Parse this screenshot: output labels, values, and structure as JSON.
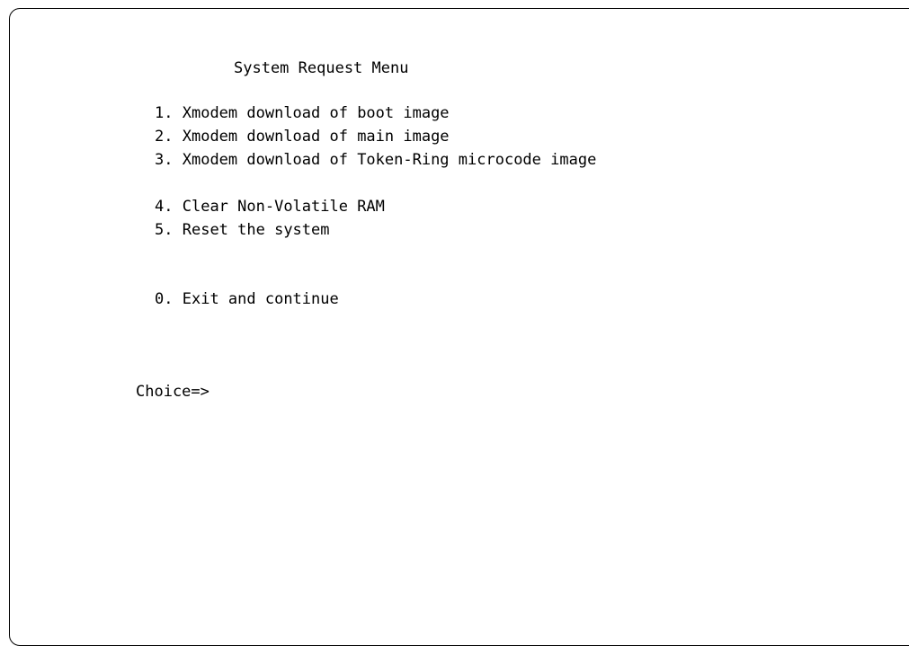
{
  "menu": {
    "title": "System Request Menu",
    "items": [
      {
        "key": "1.",
        "label": "Xmodem download of boot image"
      },
      {
        "key": "2.",
        "label": "Xmodem download of main image"
      },
      {
        "key": "3.",
        "label": "Xmodem download of Token-Ring microcode image"
      },
      {
        "key": "4.",
        "label": "Clear Non-Volatile RAM"
      },
      {
        "key": "5.",
        "label": "Reset the system"
      },
      {
        "key": "0.",
        "label": "Exit and continue"
      }
    ]
  },
  "prompt": {
    "label": "Choice=>",
    "value": ""
  }
}
